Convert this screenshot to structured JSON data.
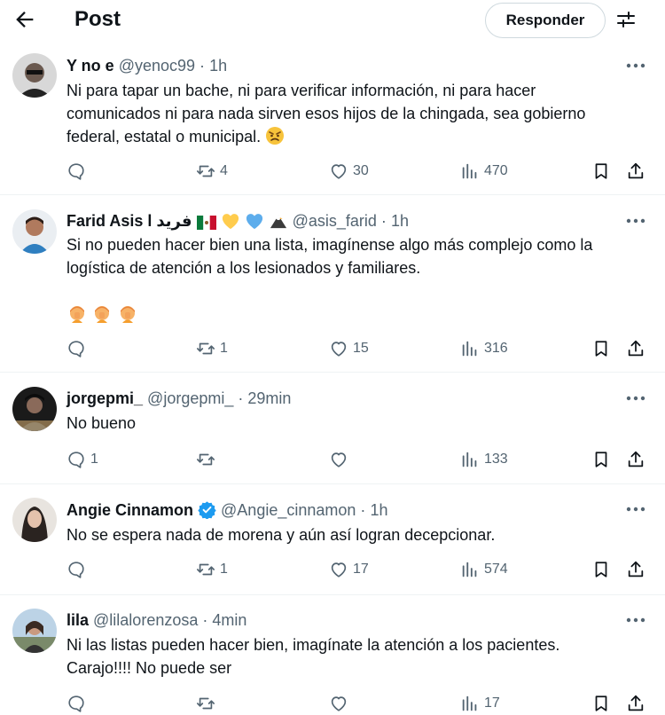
{
  "header": {
    "title": "Post",
    "reply_label": "Responder",
    "back_icon": "arrow-left-icon",
    "settings_icon": "sliders-icon"
  },
  "colors": {
    "text": "#0f1419",
    "secondary": "#536471",
    "border": "#cfd9de",
    "verified": "#1d9bf0"
  },
  "tweets": [
    {
      "name": "Y no e",
      "handle": "@yenoc99",
      "dot": "·",
      "time": "1h",
      "text_lines": [
        "Ni para tapar un bache, ni para verificar información, ni para hacer",
        "comunicados ni para nada sirven esos hijos de la chingada, sea gobierno",
        "federal, estatal o municipal."
      ],
      "emoji_after_text": "angry-face-emoji",
      "replies": "",
      "reposts": "4",
      "likes": "30",
      "views": "470"
    },
    {
      "name": "Farid Asis l فريد",
      "name_emojis": [
        "mexico-flag-emoji",
        "yellow-heart-emoji",
        "blue-heart-emoji",
        "eagle-emoji"
      ],
      "handle": "@asis_farid",
      "dot": "·",
      "time": "1h",
      "text_lines": [
        "Si no pueden hacer bien una lista, imagínense algo más complejo como la",
        "logística de atención a los lesionados y familiares."
      ],
      "extra_emojis": [
        "facepalm-emoji",
        "facepalm-emoji",
        "facepalm-emoji"
      ],
      "replies": "",
      "reposts": "1",
      "likes": "15",
      "views": "316"
    },
    {
      "name": "jorgepmi_",
      "handle": "@jorgepmi_",
      "dot": "·",
      "time": "29min",
      "text_lines": [
        "No bueno"
      ],
      "replies": "1",
      "reposts": "",
      "likes": "",
      "views": "133"
    },
    {
      "name": "Angie Cinnamon",
      "verified": true,
      "handle": "@Angie_cinnamon",
      "dot": "·",
      "time": "1h",
      "text_lines": [
        "No se espera nada de morena y aún así logran decepcionar."
      ],
      "replies": "",
      "reposts": "1",
      "likes": "17",
      "views": "574"
    },
    {
      "name": "lila",
      "handle": "@lilalorenzosa",
      "dot": "·",
      "time": "4min",
      "text_lines": [
        "Ni las listas pueden hacer bien, imagínate la atención a los pacientes.",
        "Carajo!!!! No puede ser"
      ],
      "replies": "",
      "reposts": "",
      "likes": "",
      "views": "17"
    }
  ]
}
